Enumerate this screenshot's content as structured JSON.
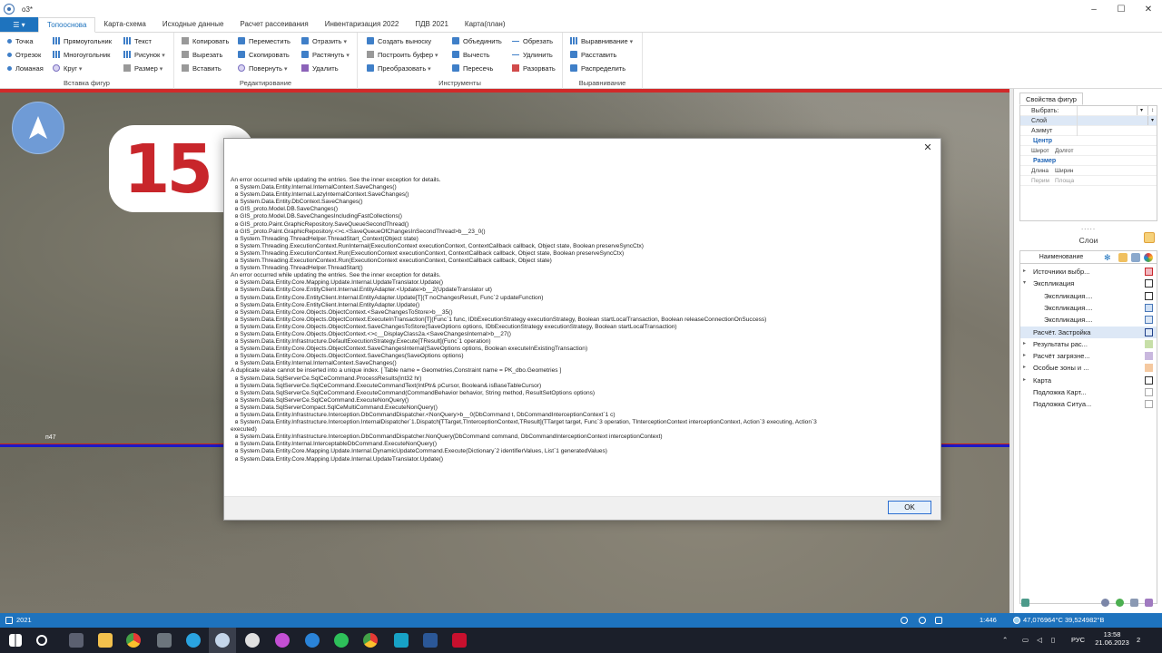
{
  "window": {
    "title": "o3*"
  },
  "ribbon_tabs": [
    {
      "label": "Топооснова",
      "active": true
    },
    {
      "label": "Карта-схема",
      "active": false
    },
    {
      "label": "Исходные данные",
      "active": false
    },
    {
      "label": "Расчет рассеивания",
      "active": false
    },
    {
      "label": "Инвентаризация 2022",
      "active": false
    },
    {
      "label": "ПДВ 2021",
      "active": false
    },
    {
      "label": "Карта(план)",
      "active": false
    }
  ],
  "ribbon_groups": {
    "insert": {
      "label": "Вставка фигур",
      "items": [
        "Точка",
        "Прямоугольник",
        "Текст",
        "Отрезок",
        "Многоугольник",
        "Рисунок",
        "Ломаная",
        "Круг",
        "Размер"
      ]
    },
    "edit": {
      "label": "Редактирование",
      "items": [
        "Копировать",
        "Переместить",
        "Отразить",
        "Вырезать",
        "Скопировать",
        "Растянуть",
        "Вставить",
        "Повернуть",
        "Удалить"
      ]
    },
    "tools": {
      "label": "Инструменты",
      "items": [
        "Создать выноску",
        "Объединить",
        "Обрезать",
        "Построить буфер",
        "Вычесть",
        "Удлинить",
        "Преобразовать",
        "Пересечь",
        "Разорвать"
      ]
    },
    "align": {
      "label": "Выравнивание",
      "items": [
        "Выравнивание",
        "Расставить",
        "Распределить"
      ]
    }
  },
  "map": {
    "sign_text": "15",
    "road_label": "п47"
  },
  "dialog": {
    "lines": [
      {
        "t": "An error occurred while updating the entries. See the inner exception for details.",
        "indent": false
      },
      {
        "t": "в System.Data.Entity.Internal.InternalContext.SaveChanges()",
        "indent": true
      },
      {
        "t": "в System.Data.Entity.Internal.LazyInternalContext.SaveChanges()",
        "indent": true
      },
      {
        "t": "в System.Data.Entity.DbContext.SaveChanges()",
        "indent": true
      },
      {
        "t": "в GIS_proto.Model.DB.SaveChanges()",
        "indent": true
      },
      {
        "t": "в GIS_proto.Model.DB.SaveChangesIncludingFastCollections()",
        "indent": true
      },
      {
        "t": "в GIS_proto.Paint.GraphicRepository.SaveQueueSecondThread()",
        "indent": true
      },
      {
        "t": "в GIS_proto.Paint.GraphicRepository.<>c.<SaveQueueOfChangesInSecondThread>b__23_0()",
        "indent": true
      },
      {
        "t": "в System.Threading.ThreadHelper.ThreadStart_Context(Object state)",
        "indent": true
      },
      {
        "t": "в System.Threading.ExecutionContext.RunInternal(ExecutionContext executionContext, ContextCallback callback, Object state, Boolean preserveSyncCtx)",
        "indent": true
      },
      {
        "t": "в System.Threading.ExecutionContext.Run(ExecutionContext executionContext, ContextCallback callback, Object state, Boolean preserveSyncCtx)",
        "indent": true
      },
      {
        "t": "в System.Threading.ExecutionContext.Run(ExecutionContext executionContext, ContextCallback callback, Object state)",
        "indent": true
      },
      {
        "t": "в System.Threading.ThreadHelper.ThreadStart()",
        "indent": true
      },
      {
        "t": "An error occurred while updating the entries. See the inner exception for details.",
        "indent": false
      },
      {
        "t": "в System.Data.Entity.Core.Mapping.Update.Internal.UpdateTranslator.Update()",
        "indent": true
      },
      {
        "t": "в System.Data.Entity.Core.EntityClient.Internal.EntityAdapter.<Update>b__2(UpdateTranslator ut)",
        "indent": true
      },
      {
        "t": "в System.Data.Entity.Core.EntityClient.Internal.EntityAdapter.Update[T](T noChangesResult, Func`2 updateFunction)",
        "indent": true
      },
      {
        "t": "в System.Data.Entity.Core.EntityClient.Internal.EntityAdapter.Update()",
        "indent": true
      },
      {
        "t": "в System.Data.Entity.Core.Objects.ObjectContext.<SaveChangesToStore>b__35()",
        "indent": true
      },
      {
        "t": "в System.Data.Entity.Core.Objects.ObjectContext.ExecuteInTransaction[T](Func`1 func, IDbExecutionStrategy executionStrategy, Boolean startLocalTransaction, Boolean releaseConnectionOnSuccess)",
        "indent": true
      },
      {
        "t": "в System.Data.Entity.Core.Objects.ObjectContext.SaveChangesToStore(SaveOptions options, IDbExecutionStrategy executionStrategy, Boolean startLocalTransaction)",
        "indent": true
      },
      {
        "t": "в System.Data.Entity.Core.Objects.ObjectContext.<>c__DisplayClass2a.<SaveChangesInternal>b__27()",
        "indent": true
      },
      {
        "t": "в System.Data.Entity.Infrastructure.DefaultExecutionStrategy.Execute[TResult](Func`1 operation)",
        "indent": true
      },
      {
        "t": "в System.Data.Entity.Core.Objects.ObjectContext.SaveChangesInternal(SaveOptions options, Boolean executeInExistingTransaction)",
        "indent": true
      },
      {
        "t": "в System.Data.Entity.Core.Objects.ObjectContext.SaveChanges(SaveOptions options)",
        "indent": true
      },
      {
        "t": "в System.Data.Entity.Internal.InternalContext.SaveChanges()",
        "indent": true
      },
      {
        "t": "A duplicate value cannot be inserted into a unique index. [ Table name = Geometries,Constraint name = PK_dbo.Geometries ]",
        "indent": false
      },
      {
        "t": "в System.Data.SqlServerCe.SqlCeCommand.ProcessResults(Int32 hr)",
        "indent": true
      },
      {
        "t": "в System.Data.SqlServerCe.SqlCeCommand.ExecuteCommandText(IntPtr& pCursor, Boolean& isBaseTableCursor)",
        "indent": true
      },
      {
        "t": "в System.Data.SqlServerCe.SqlCeCommand.ExecuteCommand(CommandBehavior behavior, String method, ResultSetOptions options)",
        "indent": true
      },
      {
        "t": "в System.Data.SqlServerCe.SqlCeCommand.ExecuteNonQuery()",
        "indent": true
      },
      {
        "t": "в System.Data.SqlServerCompact.SqlCeMultiCommand.ExecuteNonQuery()",
        "indent": true
      },
      {
        "t": "в System.Data.Entity.Infrastructure.Interception.DbCommandDispatcher.<NonQuery>b__0(DbCommand t, DbCommandInterceptionContext`1 c)",
        "indent": true
      },
      {
        "t": "в System.Data.Entity.Infrastructure.Interception.InternalDispatcher`1.Dispatch[TTarget,TInterceptionContext,TResult](TTarget target, Func`3 operation, TInterceptionContext interceptionContext, Action`3 executing, Action`3",
        "indent": true
      },
      {
        "t": "executed)",
        "indent": false
      },
      {
        "t": "в System.Data.Entity.Infrastructure.Interception.DbCommandDispatcher.NonQuery(DbCommand command, DbCommandInterceptionContext interceptionContext)",
        "indent": true
      },
      {
        "t": "в System.Data.Entity.Internal.InterceptableDbCommand.ExecuteNonQuery()",
        "indent": true
      },
      {
        "t": "в System.Data.Entity.Core.Mapping.Update.Internal.DynamicUpdateCommand.Execute(Dictionary`2 identifierValues, List`1 generatedValues)",
        "indent": true
      },
      {
        "t": "в System.Data.Entity.Core.Mapping.Update.Internal.UpdateTranslator.Update()",
        "indent": true
      }
    ],
    "ok_label": "OK"
  },
  "right_panel": {
    "props_tab": "Свойства фигур",
    "props": {
      "select_label": "Выбрать:",
      "layer_label": "Слой",
      "azimuth_label": "Азимут",
      "center_header": "Центр",
      "lat_label": "Широт",
      "lon_label": "Долгот",
      "size_header": "Размер",
      "length_label": "Длина",
      "width_label": "Ширин",
      "perim_label": "Перим",
      "area_label": "Площа"
    },
    "layers_title": "Слои",
    "layers_header": "Наименование",
    "layers": [
      {
        "label": "Источники выбр...",
        "level": 0,
        "expand": "▸",
        "color": "#f2b8c0",
        "border": "#c8262b"
      },
      {
        "label": "Экспликация",
        "level": 0,
        "expand": "▾",
        "color": "#ffffff",
        "border": "#333333"
      },
      {
        "label": "Экспликация....",
        "level": 1,
        "expand": "",
        "color": "#ffffff",
        "border": "#333333"
      },
      {
        "label": "Экспликация....",
        "level": 1,
        "expand": "",
        "color": "#cfe0f5",
        "border": "#4a78b8"
      },
      {
        "label": "Экспликация....",
        "level": 1,
        "expand": "",
        "color": "#dde8f6",
        "border": "#4a78b8"
      },
      {
        "label": "Расчёт. Застройка",
        "level": 0,
        "expand": "",
        "color": "#dde8f6",
        "border": "#1e3f8a",
        "selected": true
      },
      {
        "label": "Результаты рас...",
        "level": 0,
        "expand": "▸",
        "color": "#c7dfa8",
        "border": "#c7dfa8"
      },
      {
        "label": "Расчёт загрязне...",
        "level": 0,
        "expand": "▸",
        "color": "#c9b8de",
        "border": "#c9b8de"
      },
      {
        "label": "Особые зоны и ...",
        "level": 0,
        "expand": "▸",
        "color": "#f5c9a0",
        "border": "#f5c9a0"
      },
      {
        "label": "Карта",
        "level": 0,
        "expand": "▸",
        "color": "#ffffff",
        "border": "#333333"
      },
      {
        "label": "Подложка Карт...",
        "level": 0,
        "expand": "",
        "color": "#ffffff",
        "border": "#aaaaaa"
      },
      {
        "label": "Подложка Ситуа...",
        "level": 0,
        "expand": "",
        "color": "#ffffff",
        "border": "#aaaaaa"
      }
    ]
  },
  "statusbar": {
    "year": "2021",
    "scale": "1:446",
    "coords": "47,076964°С 39,524982°В"
  },
  "taskbar": {
    "lang": "РУС",
    "time": "13:58",
    "date": "21.06.2023",
    "notif": "2"
  },
  "colors": {
    "accent": "#1e73be",
    "road_blue": "#1a1ac8",
    "road_red": "#c91e1e"
  }
}
